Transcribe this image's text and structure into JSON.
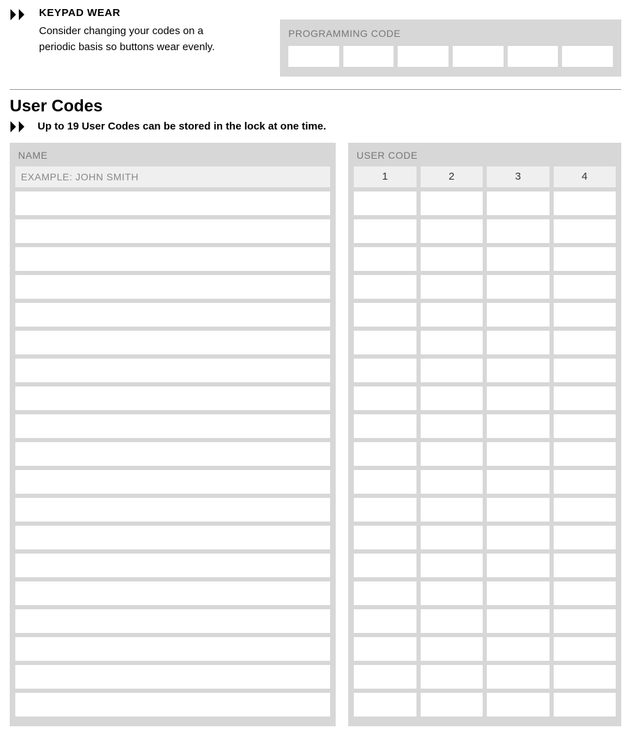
{
  "tip": {
    "title": "KEYPAD WEAR",
    "body": "Consider changing your codes on a periodic basis so buttons wear evenly."
  },
  "programming": {
    "label": "PROGRAMMING CODE",
    "cell_count": 6
  },
  "user_codes": {
    "heading": "User Codes",
    "note": "Up to 19 User Codes can be stored in the lock at one time.",
    "name_header": "NAME",
    "example": "EXAMPLE: JOHN SMITH",
    "code_header": "USER CODE",
    "digit_labels": [
      "1",
      "2",
      "3",
      "4"
    ],
    "row_count": 19
  }
}
